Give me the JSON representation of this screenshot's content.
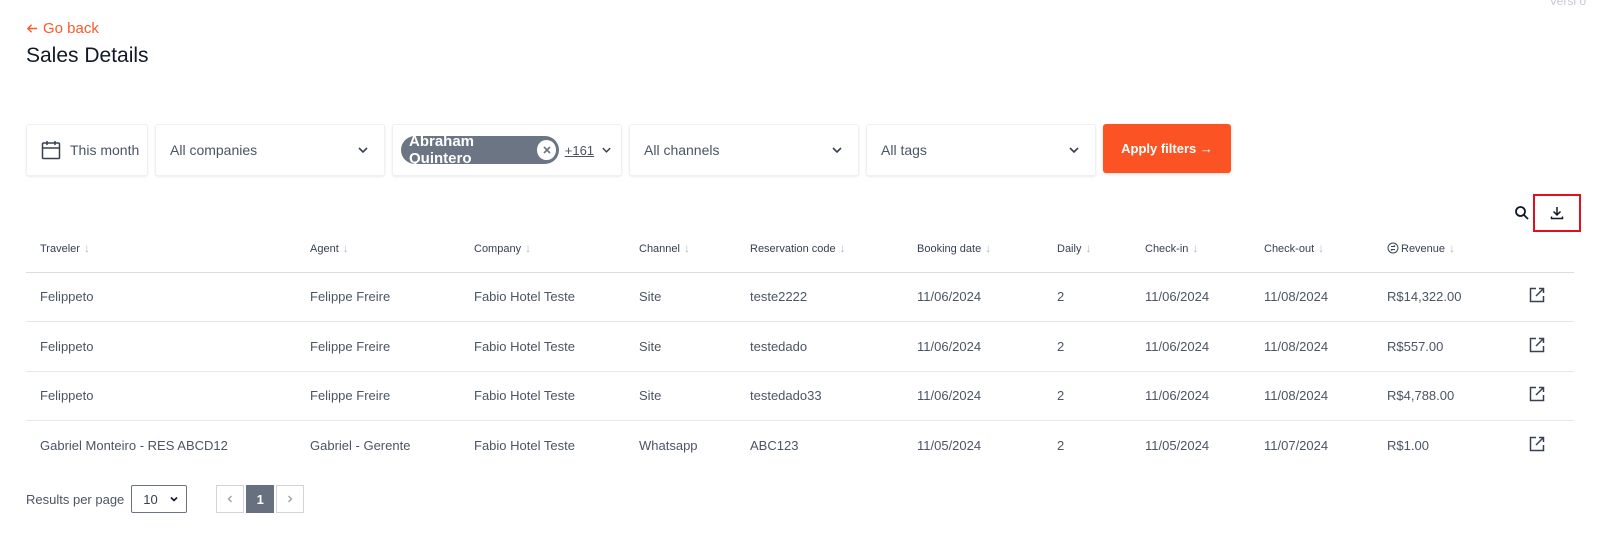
{
  "version_label": "Versi o",
  "nav": {
    "go_back": "Go back"
  },
  "page_title": "Sales Details",
  "filters": {
    "date": "This month",
    "companies": "All companies",
    "agent_chip": "Abraham Quintero",
    "agent_more": "+161",
    "channels": "All channels",
    "tags": "All tags",
    "apply": "Apply filters →"
  },
  "table": {
    "columns": [
      "Traveler",
      "Agent",
      "Company",
      "Channel",
      "Reservation code",
      "Booking date",
      "Daily",
      "Check-in",
      "Check-out",
      "Revenue"
    ],
    "rows": [
      [
        "Felippeto",
        "Felippe Freire",
        "Fabio Hotel Teste",
        "Site",
        "teste2222",
        "11/06/2024",
        "2",
        "11/06/2024",
        "11/08/2024",
        "R$14,322.00"
      ],
      [
        "Felippeto",
        "Felippe Freire",
        "Fabio Hotel Teste",
        "Site",
        "testedado",
        "11/06/2024",
        "2",
        "11/06/2024",
        "11/08/2024",
        "R$557.00"
      ],
      [
        "Felippeto",
        "Felippe Freire",
        "Fabio Hotel Teste",
        "Site",
        "testedado33",
        "11/06/2024",
        "2",
        "11/06/2024",
        "11/08/2024",
        "R$4,788.00"
      ],
      [
        "Gabriel Monteiro - RES ABCD12",
        "Gabriel - Gerente",
        "Fabio Hotel Teste",
        "Whatsapp",
        "ABC123",
        "11/05/2024",
        "2",
        "11/05/2024",
        "11/07/2024",
        "R$1.00"
      ]
    ]
  },
  "pagination": {
    "results_per_page_label": "Results per page",
    "results_per_page_value": "10",
    "current_page": "1"
  },
  "colors": {
    "accent": "#fb5323",
    "chip": "#6b7584",
    "highlight": "#e0111d"
  }
}
